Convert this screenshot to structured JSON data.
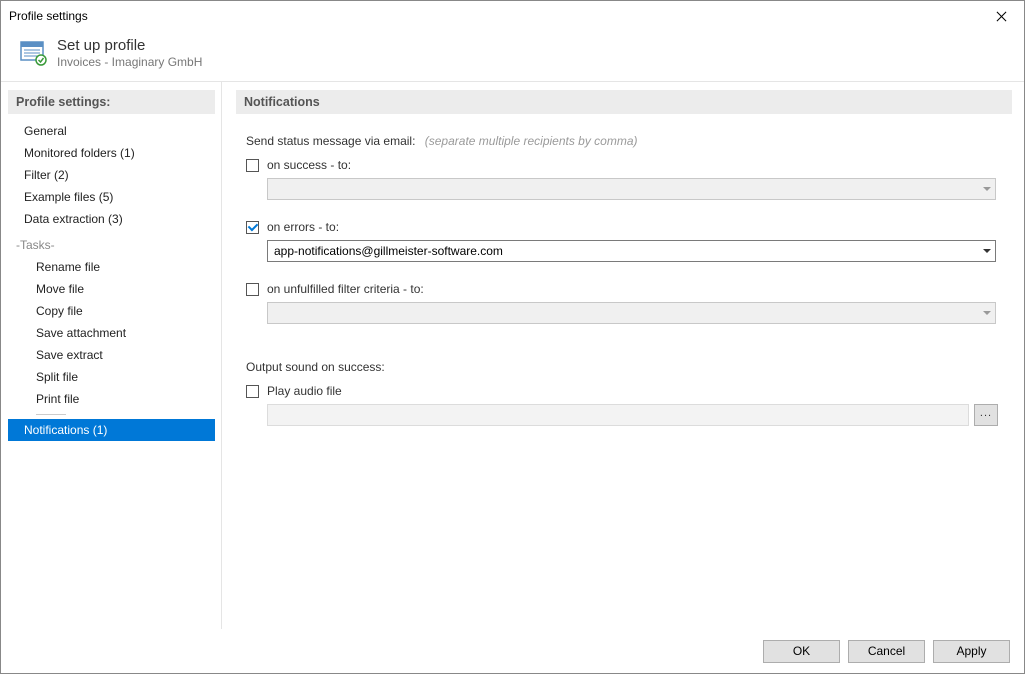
{
  "window": {
    "title": "Profile settings"
  },
  "header": {
    "title": "Set up profile",
    "subtitle": "Invoices - Imaginary GmbH"
  },
  "sidebar": {
    "header": "Profile settings:",
    "items": [
      {
        "label": "General",
        "type": "item"
      },
      {
        "label": "Monitored folders (1)",
        "type": "item"
      },
      {
        "label": "Filter (2)",
        "type": "item"
      },
      {
        "label": "Example files (5)",
        "type": "item"
      },
      {
        "label": "Data extraction (3)",
        "type": "item"
      },
      {
        "label": "-Tasks-",
        "type": "section"
      },
      {
        "label": "Rename file",
        "type": "sub"
      },
      {
        "label": "Move file",
        "type": "sub"
      },
      {
        "label": "Copy file",
        "type": "sub"
      },
      {
        "label": "Save attachment",
        "type": "sub"
      },
      {
        "label": "Save extract",
        "type": "sub"
      },
      {
        "label": "Split file",
        "type": "sub"
      },
      {
        "label": "Print file",
        "type": "sub"
      },
      {
        "label": "divider",
        "type": "divider"
      },
      {
        "label": "Notifications (1)",
        "type": "item",
        "selected": true
      }
    ]
  },
  "content": {
    "header": "Notifications",
    "email_label": "Send status message via email:",
    "email_hint": "(separate multiple recipients by comma)",
    "success": {
      "label": "on success - to:",
      "checked": false,
      "value": ""
    },
    "errors": {
      "label": "on errors - to:",
      "checked": true,
      "value": "app-notifications@gillmeister-software.com"
    },
    "unfulfilled": {
      "label": "on unfulfilled filter criteria - to:",
      "checked": false,
      "value": ""
    },
    "sound_label": "Output sound on success:",
    "play_audio": {
      "label": "Play audio file",
      "checked": false,
      "value": ""
    },
    "browse_label": "..."
  },
  "footer": {
    "ok": "OK",
    "cancel": "Cancel",
    "apply": "Apply"
  }
}
